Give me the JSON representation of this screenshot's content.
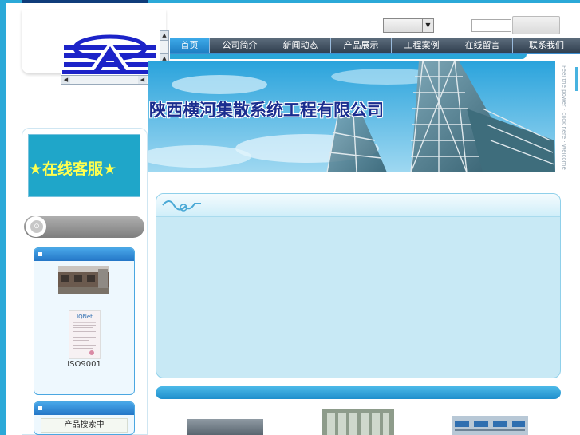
{
  "company": {
    "name": "陕西横河集散系统工程有限公司",
    "tagline": "Feel the power · click here · Welcome to DCS automatisation"
  },
  "header": {
    "select_value": "",
    "search_placeholder": "",
    "search_button_label": ""
  },
  "nav": {
    "items": [
      "首页",
      "公司简介",
      "新闻动态",
      "产品展示",
      "工程案例",
      "在线留言",
      "联系我们"
    ]
  },
  "sidebar": {
    "promo_text": "★在线客服★",
    "cert_label": "ISO9001",
    "panel2_label": "产品搜索中"
  },
  "colors": {
    "accent": "#2ba9d8",
    "nav_active": "#2a95d6",
    "title": "#1a2d8f",
    "promo_text": "#ffff4f"
  },
  "icons": {
    "scroll_up": "triangle-up",
    "scroll_down": "triangle-down",
    "scroll_left": "triangle-left",
    "scroll_right": "triangle-right",
    "select_arrow": "triangle-down"
  }
}
